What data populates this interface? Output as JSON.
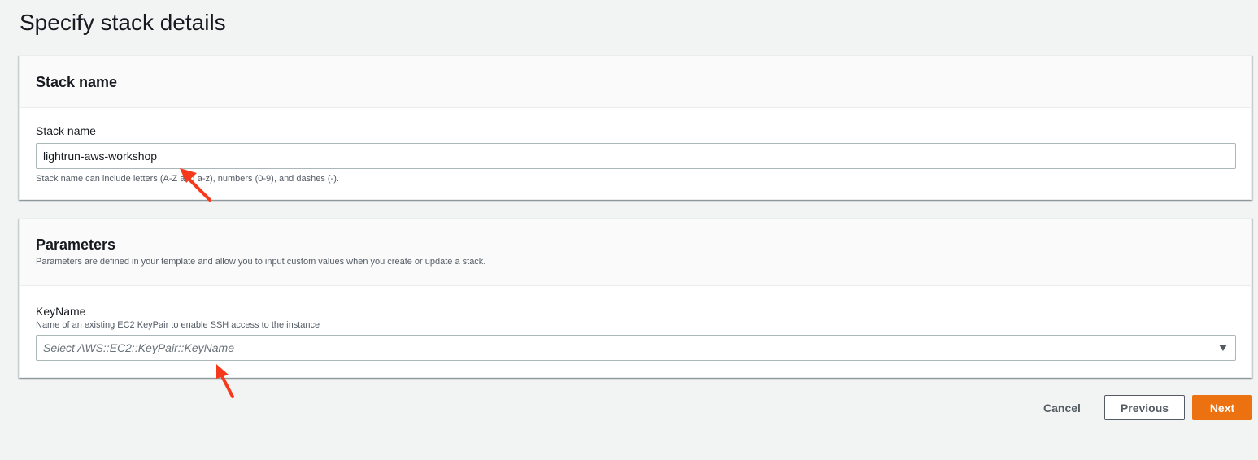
{
  "page": {
    "title": "Specify stack details"
  },
  "stack_panel": {
    "title": "Stack name",
    "field_label": "Stack name",
    "input_value": "lightrun-aws-workshop",
    "hint": "Stack name can include letters (A-Z and a-z), numbers (0-9), and dashes (-)."
  },
  "params_panel": {
    "title": "Parameters",
    "description": "Parameters are defined in your template and allow you to input custom values when you create or update a stack.",
    "keyname": {
      "label": "KeyName",
      "description": "Name of an existing EC2 KeyPair to enable SSH access to the instance",
      "placeholder": "Select AWS::EC2::KeyPair::KeyName"
    }
  },
  "actions": {
    "cancel": "Cancel",
    "previous": "Previous",
    "next": "Next"
  },
  "colors": {
    "primary_button": "#ec7211",
    "annotation_arrow": "#f53a1b",
    "background": "#f2f3f3"
  }
}
